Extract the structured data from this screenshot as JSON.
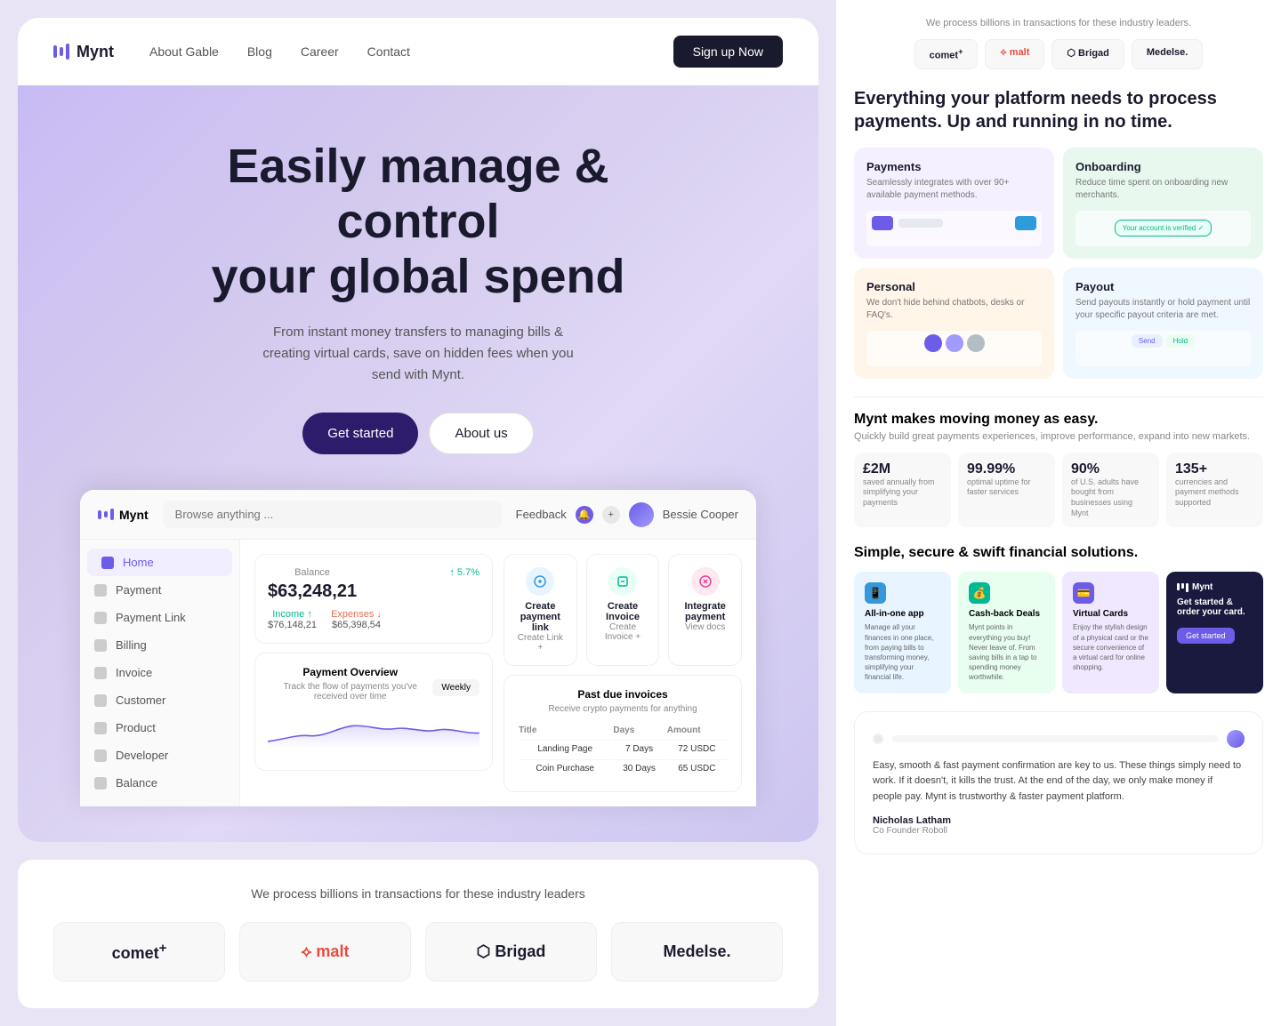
{
  "navbar": {
    "logo_text": "Mynt",
    "links": [
      {
        "label": "About Gable"
      },
      {
        "label": "Blog"
      },
      {
        "label": "Career"
      },
      {
        "label": "Contact"
      }
    ],
    "cta_label": "Sign up Now"
  },
  "hero": {
    "headline_line1": "Easily manage & control",
    "headline_line2": "your global spend",
    "subtext": "From instant money transfers to managing bills & creating virtual cards, save on hidden fees when you send with Mynt.",
    "btn_primary": "Get started",
    "btn_secondary": "About us"
  },
  "dashboard": {
    "logo": "Mynt",
    "search_placeholder": "Browse anything ...",
    "feedback_label": "Feedback",
    "user_name": "Bessie Cooper",
    "nav_items": [
      {
        "label": "Home",
        "active": true
      },
      {
        "label": "Payment"
      },
      {
        "label": "Payment Link"
      },
      {
        "label": "Billing"
      },
      {
        "label": "Invoice"
      },
      {
        "label": "Customer"
      },
      {
        "label": "Product"
      },
      {
        "label": "Developer"
      },
      {
        "label": "Balance"
      }
    ],
    "balance": {
      "label": "Balance",
      "amount": "$63,248,21",
      "change": "5.7%",
      "income_label": "Income ↑",
      "income_value": "$76,148,21",
      "expense_label": "Expenses ↓",
      "expense_value": "$65,398,54"
    },
    "quick_actions": [
      {
        "title": "Create payment link",
        "sub": "Create Link +"
      },
      {
        "title": "Create Invoice",
        "sub": "Create Invoice +"
      },
      {
        "title": "Integrate payment",
        "sub": "View docs"
      }
    ],
    "payment_overview": {
      "title": "Payment Overview",
      "sub": "Track the flow of payments you've received over time",
      "period": "Weekly"
    },
    "past_due": {
      "title": "Past due invoices",
      "sub": "Receive crypto payments for anything",
      "columns": [
        "Title",
        "Days",
        "Amount"
      ],
      "rows": [
        {
          "title": "Landing Page",
          "days": "7 Days",
          "amount": "72 USDC"
        },
        {
          "title": "Coin Purchase",
          "days": "30 Days",
          "amount": "65 USDC"
        }
      ]
    }
  },
  "partners": {
    "label": "We process billions in transactions for these industry leaders",
    "logos": [
      {
        "name": "comet+",
        "display": "comet+"
      },
      {
        "name": "malt",
        "display": "⟡ malt"
      },
      {
        "name": "brigad",
        "display": "⬡ Brigad"
      },
      {
        "name": "medelse",
        "display": "Medelse."
      }
    ]
  },
  "right_panel": {
    "partners_label": "We process billions in transactions for these industry leaders.",
    "right_logos": [
      {
        "label": "comet+"
      },
      {
        "label": "⟡ malt"
      },
      {
        "label": "⬡ Brigad"
      },
      {
        "label": "Medelse."
      }
    ],
    "platform": {
      "title": "Everything your platform needs to process payments. Up and running in no time.",
      "features": [
        {
          "key": "payments",
          "title": "Payments",
          "desc": "Seamlessly integrates with over 90+ available payment methods."
        },
        {
          "key": "onboarding",
          "title": "Onboarding",
          "desc": "Reduce time spent on onboarding new merchants."
        },
        {
          "key": "personal",
          "title": "Personal",
          "desc": "We don't hide behind chatbots, desks or FAQ's."
        },
        {
          "key": "payout",
          "title": "Payout",
          "desc": "Send payouts instantly or hold payment until your specific payout criteria are met."
        }
      ]
    },
    "moving_money": {
      "title": "Mynt makes moving money as easy.",
      "sub": "Quickly build great payments experiences, improve performance, expand into new markets.",
      "stats": [
        {
          "num": "£2M",
          "desc": "saved annually from simplifying your payments"
        },
        {
          "num": "99.99%",
          "desc": "optimal uptime for faster services"
        },
        {
          "num": "90%",
          "desc": "of U.S. adults have bought from businesses using Mynt"
        },
        {
          "num": "135+",
          "desc": "currencies and payment methods supported"
        }
      ]
    },
    "solutions": {
      "title": "Simple, secure & swift financial solutions.",
      "cards": [
        {
          "key": "allinone",
          "title": "All-in-one app",
          "desc": "Manage all your finances in one place, from paying bills to transforming money, simplifying your financial life."
        },
        {
          "key": "cashback",
          "title": "Cash-back Deals",
          "desc": "Mynt points in everything you buy! Never leave of. From saving bills in a tap to spending money worthwhile."
        },
        {
          "key": "virtual",
          "title": "Virtual Cards",
          "desc": "Enjoy the stylish design of a physical card or the secure convenience of a virtual card for online shopping."
        },
        {
          "key": "getstarted",
          "title": "Get started & order your card.",
          "sub": "Get started"
        }
      ]
    },
    "testimonial": {
      "text": "Easy, smooth & fast payment confirmation are key to us. These things simply need to work. If it doesn't, it kills the trust. At the end of the day, we only make money if people pay. Mynt is trustworthy & faster payment platform.",
      "author": "Nicholas Latham",
      "role": "Co Founder Roboll"
    }
  }
}
